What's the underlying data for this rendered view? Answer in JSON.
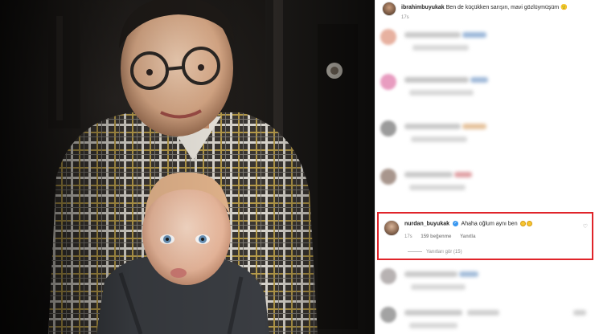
{
  "post": {
    "caption_username": "ibrahimbuyukak",
    "caption_text": "Ben de küçükken sarışın, mavi gözlüymüşüm 🙂",
    "caption_time": "17s"
  },
  "highlighted_comment": {
    "username": "nurdan_buyukak",
    "verified_icon": "verified-badge-icon",
    "text": "Ahaha oğlum aynı ben",
    "emojis": [
      "😂",
      "😂"
    ],
    "time": "17s",
    "likes": "159 beğenme",
    "reply_label": "Yanıtla",
    "view_replies_label": "Yanıtları gör (15)",
    "heart_icon": "heart-icon"
  },
  "colors": {
    "highlight_border": "#e0242a",
    "verified": "#3897f0",
    "muted_text": "#8e8e8e"
  }
}
